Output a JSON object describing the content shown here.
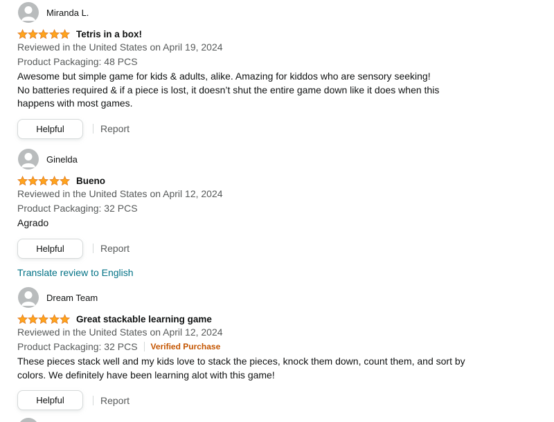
{
  "reviews": [
    {
      "reviewer": "Miranda L.",
      "rating": 5,
      "title": "Tetris in a box!",
      "reviewed_in": "Reviewed in the United States on April 19, 2024",
      "packaging": "Product Packaging: 48 PCS",
      "verified": "",
      "body_lines": [
        "Awesome but simple game for kids & adults, alike. Amazing for kiddos who are sensory seeking!",
        "No batteries required & if a piece is lost, it doesn’t shut the entire game down like it does when this",
        "happens with most games."
      ],
      "helpful_label": "Helpful",
      "report_label": "Report",
      "translate_label": ""
    },
    {
      "reviewer": "Ginelda",
      "rating": 5,
      "title": "Bueno",
      "reviewed_in": "Reviewed in the United States on April 12, 2024",
      "packaging": "Product Packaging: 32 PCS",
      "verified": "",
      "body_lines": [
        "Agrado"
      ],
      "helpful_label": "Helpful",
      "report_label": "Report",
      "translate_label": "Translate review to English"
    },
    {
      "reviewer": "Dream Team",
      "rating": 5,
      "title": "Great stackable learning game",
      "reviewed_in": "Reviewed in the United States on April 12, 2024",
      "packaging": "Product Packaging: 32 PCS",
      "verified": "Verified Purchase",
      "body_lines": [
        "These pieces stack well and my kids love to stack the pieces, knock them down, count them, and sort by",
        "colors. We definitely have been learning alot with this game!"
      ],
      "helpful_label": "Helpful",
      "report_label": "Report",
      "translate_label": ""
    }
  ],
  "colors": {
    "star": "#ffa41c",
    "star_stroke": "#de7921",
    "link": "#007185",
    "verified": "#c45500",
    "meta_text": "#565959"
  },
  "icons": {
    "avatar": "default-user-avatar-icon",
    "star": "star-icon"
  }
}
